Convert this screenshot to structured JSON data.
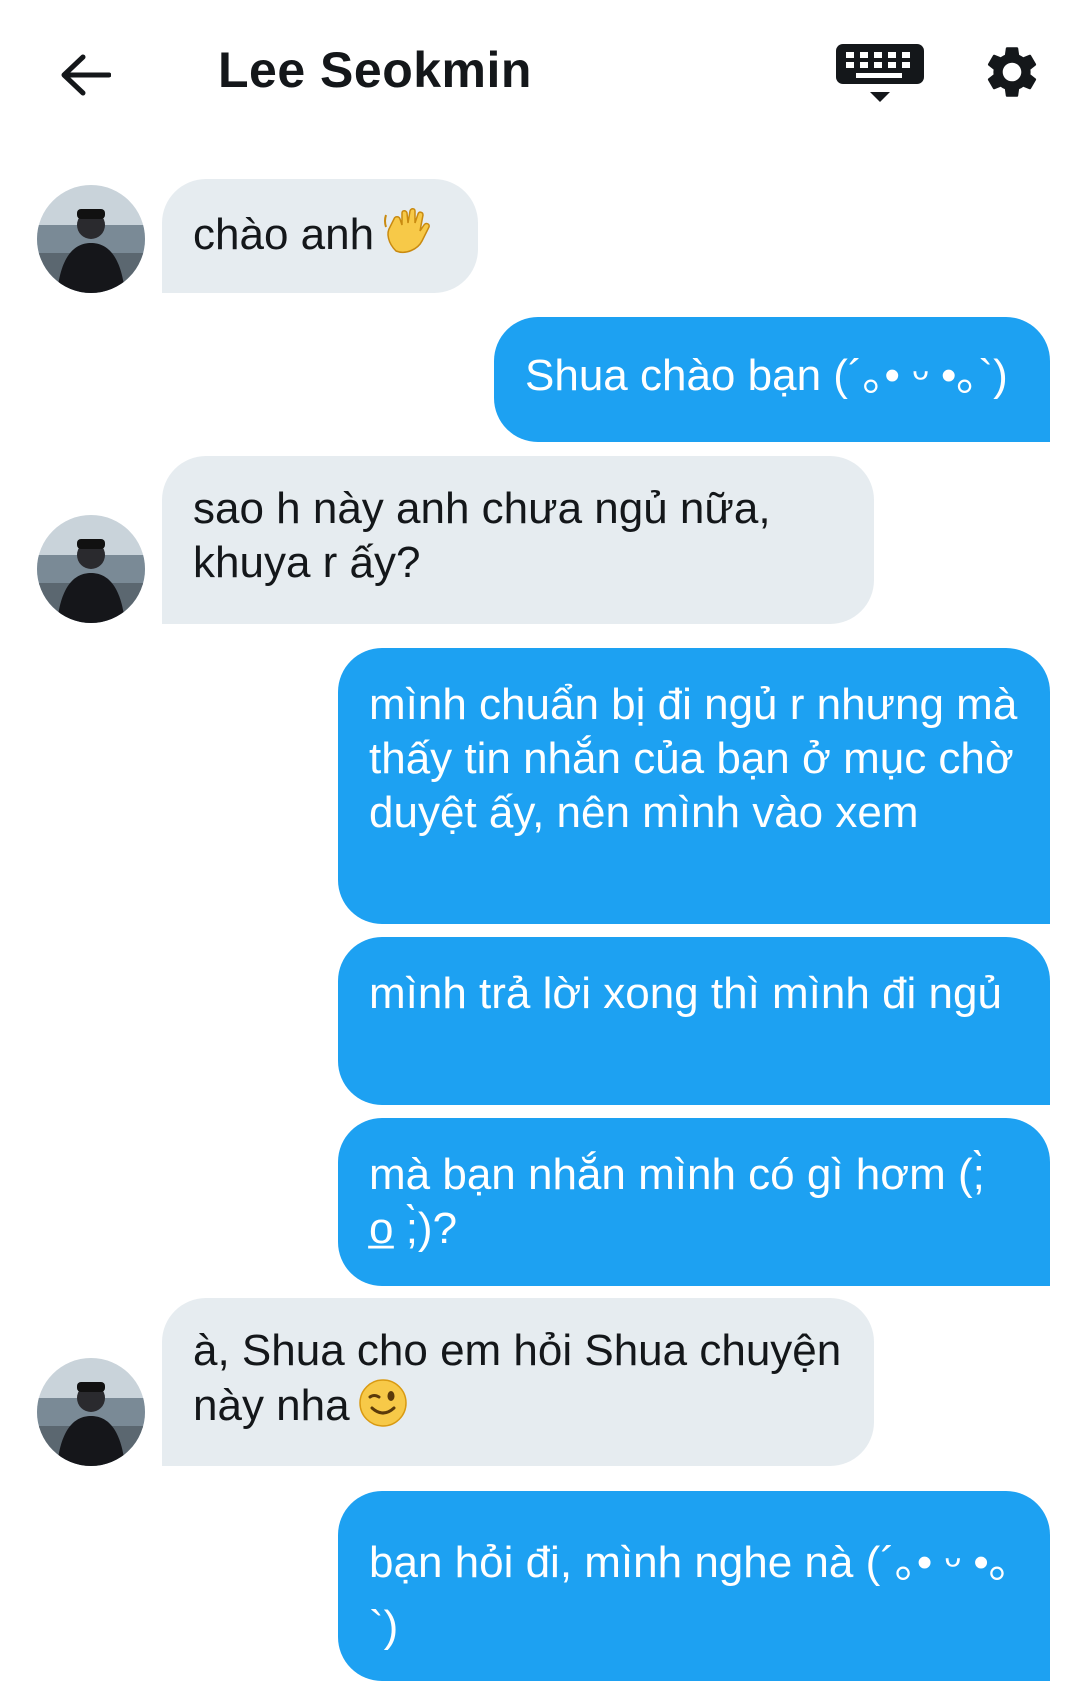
{
  "header": {
    "title": "Lee Seokmin",
    "back_icon": "arrow-left-icon",
    "keyboard_icon": "keyboard-icon",
    "settings_icon": "gear-icon"
  },
  "colors": {
    "outgoing_bubble": "#1da1f2",
    "incoming_bubble": "#e6ecf0",
    "text_dark": "#14171a"
  },
  "messages": [
    {
      "direction": "incoming",
      "text": "chào anh",
      "emoji": "waving-hand-emoji"
    },
    {
      "direction": "outgoing",
      "text": "Shua chào bạn (´｡• ᵕ •｡`)"
    },
    {
      "direction": "incoming",
      "text": "sao h này anh chưa ngủ nữa, khuya r ấy?"
    },
    {
      "direction": "outgoing",
      "text": "mình chuẩn bị đi ngủ r nhưng mà thấy tin nhắn của bạn ở mục chờ duyệt ấy, nên mình vào xem"
    },
    {
      "direction": "outgoing",
      "text": "mình trả lời xong thì mình đi ngủ"
    },
    {
      "direction": "outgoing",
      "text": "mà bạn nhắn mình có gì hơm (;̀ o̲ ;̀)?"
    },
    {
      "direction": "incoming",
      "text": "à, Shua cho em hỏi Shua chuyện này nha",
      "emoji": "winking-face-emoji"
    },
    {
      "direction": "outgoing",
      "text": "bạn hỏi đi, mình nghe nà (´｡• ᵕ •｡`)"
    }
  ]
}
